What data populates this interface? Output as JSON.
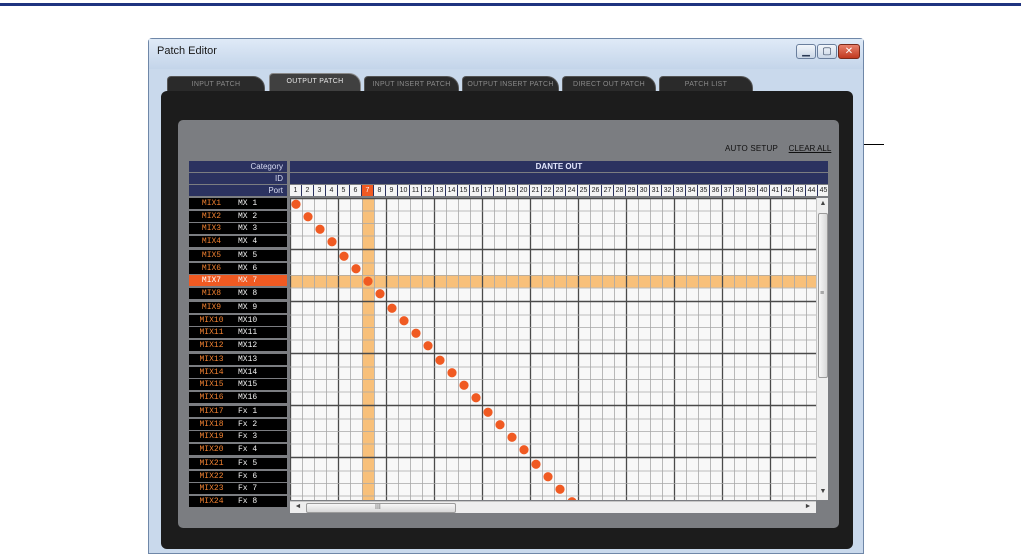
{
  "window": {
    "title": "Patch Editor",
    "minimize_glyph": "▁",
    "maximize_glyph": "▢",
    "close_glyph": "✕"
  },
  "tabs": [
    {
      "label": "INPUT PATCH",
      "active": false
    },
    {
      "label": "OUTPUT PATCH",
      "active": true
    },
    {
      "label": "INPUT INSERT PATCH",
      "active": false
    },
    {
      "label": "OUTPUT INSERT PATCH",
      "active": false
    },
    {
      "label": "DIRECT OUT PATCH",
      "active": false
    },
    {
      "label": "PATCH LIST",
      "active": false
    }
  ],
  "toolbar": {
    "auto_setup_label": "AUTO SETUP",
    "clear_all_label": "CLEAR ALL"
  },
  "grid": {
    "header": {
      "category_label": "Category",
      "id_label": "ID",
      "port_label": "Port",
      "destination": "DANTE OUT"
    },
    "ports": [
      "1",
      "2",
      "3",
      "4",
      "5",
      "6",
      "7",
      "8",
      "9",
      "10",
      "11",
      "12",
      "13",
      "14",
      "15",
      "16",
      "17",
      "18",
      "19",
      "20",
      "21",
      "22",
      "23",
      "24",
      "25",
      "26",
      "27",
      "28",
      "29",
      "30",
      "31",
      "32",
      "33",
      "34",
      "35",
      "36",
      "37",
      "38",
      "39",
      "40",
      "41",
      "42",
      "43",
      "44",
      "45"
    ],
    "selected_port": 7,
    "selected_row": 7,
    "rows": [
      {
        "category": "MIX1",
        "name": "MX 1"
      },
      {
        "category": "MIX2",
        "name": "MX 2"
      },
      {
        "category": "MIX3",
        "name": "MX 3"
      },
      {
        "category": "MIX4",
        "name": "MX 4"
      },
      {
        "category": "MIX5",
        "name": "MX 5"
      },
      {
        "category": "MIX6",
        "name": "MX 6"
      },
      {
        "category": "MIX7",
        "name": "MX 7"
      },
      {
        "category": "MIX8",
        "name": "MX 8"
      },
      {
        "category": "MIX9",
        "name": "MX 9"
      },
      {
        "category": "MIX10",
        "name": "MX10"
      },
      {
        "category": "MIX11",
        "name": "MX11"
      },
      {
        "category": "MIX12",
        "name": "MX12"
      },
      {
        "category": "MIX13",
        "name": "MX13"
      },
      {
        "category": "MIX14",
        "name": "MX14"
      },
      {
        "category": "MIX15",
        "name": "MX15"
      },
      {
        "category": "MIX16",
        "name": "MX16"
      },
      {
        "category": "MIX17",
        "name": "Fx 1"
      },
      {
        "category": "MIX18",
        "name": "Fx 2"
      },
      {
        "category": "MIX19",
        "name": "Fx 3"
      },
      {
        "category": "MIX20",
        "name": "Fx 4"
      },
      {
        "category": "MIX21",
        "name": "Fx 5"
      },
      {
        "category": "MIX22",
        "name": "Fx 6"
      },
      {
        "category": "MIX23",
        "name": "Fx 7"
      },
      {
        "category": "MIX24",
        "name": "Fx 8"
      }
    ],
    "patches": [
      [
        1,
        1
      ],
      [
        2,
        2
      ],
      [
        3,
        3
      ],
      [
        4,
        4
      ],
      [
        5,
        5
      ],
      [
        6,
        6
      ],
      [
        7,
        7
      ],
      [
        8,
        8
      ],
      [
        9,
        9
      ],
      [
        10,
        10
      ],
      [
        11,
        11
      ],
      [
        12,
        12
      ],
      [
        13,
        13
      ],
      [
        14,
        14
      ],
      [
        15,
        15
      ],
      [
        16,
        16
      ],
      [
        17,
        17
      ],
      [
        18,
        18
      ],
      [
        19,
        19
      ],
      [
        20,
        20
      ],
      [
        21,
        21
      ],
      [
        22,
        22
      ],
      [
        23,
        23
      ],
      [
        24,
        24
      ]
    ],
    "colors": {
      "patch_dot": "#f05a22",
      "highlight": "#f8c07a",
      "selected": "#f05a22",
      "category_text": "#f08030"
    }
  },
  "scrollbars": {
    "up_arrow": "▲",
    "down_arrow": "▼",
    "left_arrow": "◄",
    "right_arrow": "►",
    "grip": "III",
    "vgrip": "≡"
  }
}
